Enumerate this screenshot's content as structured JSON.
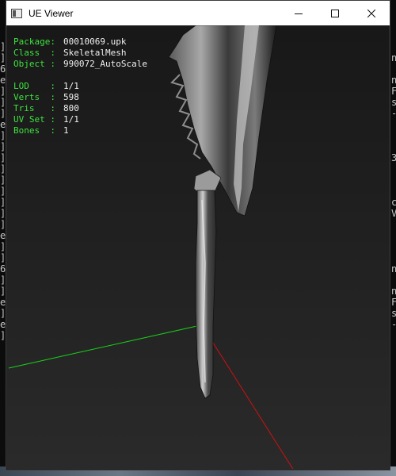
{
  "window": {
    "title": "UE Viewer"
  },
  "controls": {
    "minimize_icon": "minimize-icon",
    "maximize_icon": "maximize-icon",
    "close_icon": "close-icon"
  },
  "info_top": [
    {
      "key": "Package:",
      "value": "00010069.upk"
    },
    {
      "key": "Class  :",
      "value": "SkeletalMesh"
    },
    {
      "key": "Object :",
      "value": "990072_AutoScale"
    }
  ],
  "info_mesh": [
    {
      "key": "LOD    :",
      "value": "1/1"
    },
    {
      "key": "Verts  :",
      "value": "598"
    },
    {
      "key": "Tris   :",
      "value": "800"
    },
    {
      "key": "UV Set :",
      "value": "1/1"
    },
    {
      "key": "Bones  :",
      "value": "1"
    }
  ],
  "background_left_chars": [
    "]",
    "]",
    "6",
    "e",
    "]",
    "]",
    "]",
    "e",
    "]",
    "]",
    "]",
    "]",
    "]",
    "]",
    "]",
    "]",
    "]",
    "e",
    "]",
    "]",
    "6",
    "]",
    "]",
    "e",
    "]",
    "e",
    "]"
  ],
  "background_right_chars": [
    "n",
    "",
    "n",
    "F",
    "s",
    "-",
    "",
    "",
    "",
    "3",
    "",
    "",
    "",
    "c",
    "V",
    "",
    "",
    "",
    "",
    "n",
    "",
    "n",
    "F",
    "s",
    "-"
  ],
  "colors": {
    "axis_x": "#d01010",
    "axis_y": "#18d418",
    "info_key": "#3ee23e",
    "info_value": "#f0f0f0"
  }
}
